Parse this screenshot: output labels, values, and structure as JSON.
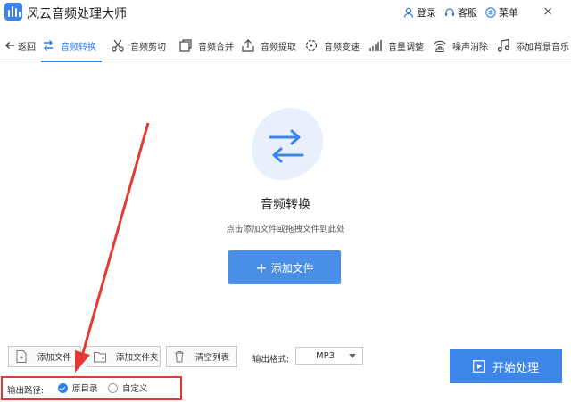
{
  "titlebar": {
    "app_title": "风云音频处理大师",
    "login": "登录",
    "service": "客服",
    "menu": "菜单",
    "close": "×"
  },
  "toolbar": {
    "back": "返回",
    "items": [
      {
        "label": "音频转换",
        "icon": "convert-icon",
        "active": true
      },
      {
        "label": "音频剪切",
        "icon": "scissors-icon"
      },
      {
        "label": "音频合并",
        "icon": "merge-icon"
      },
      {
        "label": "音频提取",
        "icon": "extract-icon"
      },
      {
        "label": "音频变速",
        "icon": "speed-icon"
      },
      {
        "label": "音量调整",
        "icon": "volume-bars-icon"
      },
      {
        "label": "噪声消除",
        "icon": "noise-icon"
      },
      {
        "label": "添加背景音乐",
        "icon": "music-note-icon"
      }
    ]
  },
  "main": {
    "title": "音频转换",
    "hint": "点击添加文件或拖拽文件到此处",
    "add_button": "添加文件"
  },
  "bottom": {
    "add_file": "添加文件",
    "add_folder": "添加文件夹",
    "clear_list": "清空列表",
    "format_label": "输出格式:",
    "format_value": "MP3",
    "start": "开始处理",
    "output_label": "输出路径:",
    "option_original": "原目录",
    "option_custom": "自定义"
  },
  "colors": {
    "accent": "#2b7de9",
    "annotation": "#e53935"
  }
}
